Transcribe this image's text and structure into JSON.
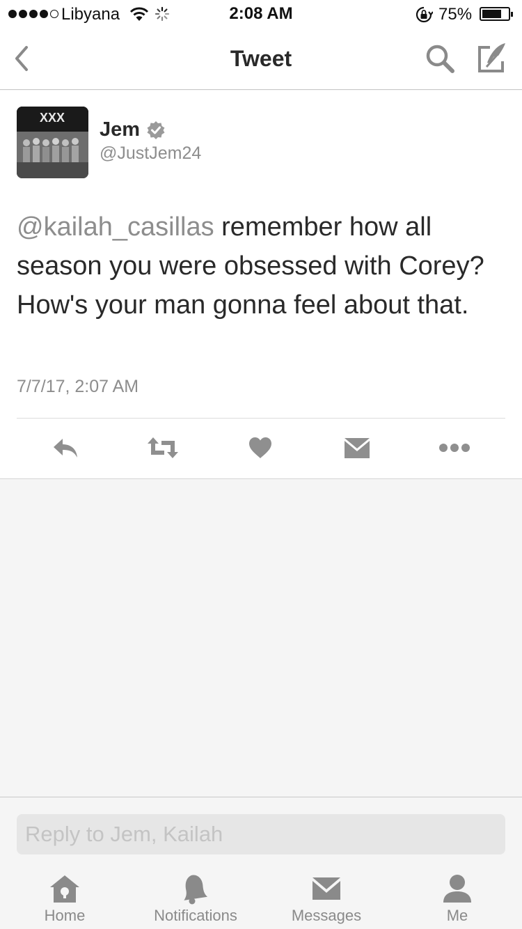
{
  "status_bar": {
    "carrier": "Libyana",
    "time": "2:08 AM",
    "battery_percent_label": "75%",
    "battery_level": 0.75,
    "signal_bars": 4,
    "signal_max": 5
  },
  "nav": {
    "title": "Tweet",
    "icons": [
      "chevron-left-icon",
      "search-icon",
      "compose-icon"
    ]
  },
  "tweet": {
    "author": {
      "name": "Jem",
      "handle": "@JustJem24",
      "verified": true,
      "avatar_banner_text": "XXX"
    },
    "mention": "@kailah_casillas",
    "body": " remember how all season you were obsessed with Corey? How's your man gonna feel about that.",
    "timestamp": "7/7/17, 2:07 AM",
    "actions": [
      "reply-icon",
      "retweet-icon",
      "like-icon",
      "direct-message-icon",
      "more-icon"
    ]
  },
  "reply": {
    "placeholder": "Reply to Jem, Kailah"
  },
  "tabs": [
    {
      "label": "Home",
      "icon": "home-icon"
    },
    {
      "label": "Notifications",
      "icon": "bell-icon"
    },
    {
      "label": "Messages",
      "icon": "envelope-icon"
    },
    {
      "label": "Me",
      "icon": "person-icon"
    }
  ],
  "colors": {
    "text": "#292929",
    "muted": "#8d8d8d",
    "icon": "#8f8f8f",
    "background": "#f5f5f5"
  }
}
